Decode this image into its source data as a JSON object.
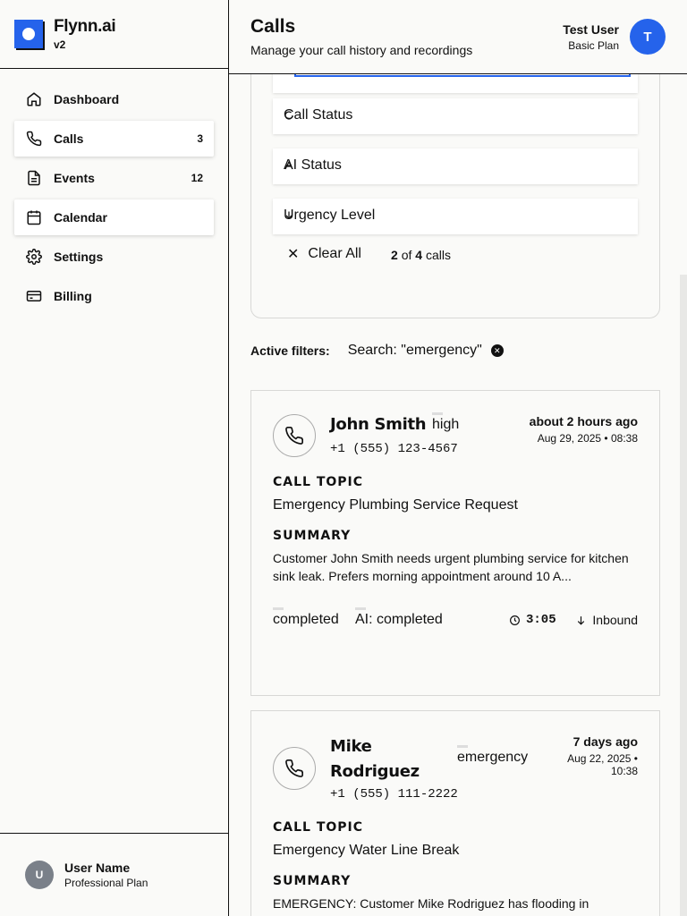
{
  "brand": {
    "name": "Flynn.ai",
    "version": "v2"
  },
  "nav": [
    {
      "label": "Dashboard",
      "icon": "home-icon",
      "count": ""
    },
    {
      "label": "Calls",
      "icon": "phone-icon",
      "count": "3"
    },
    {
      "label": "Events",
      "icon": "document-icon",
      "count": "12"
    },
    {
      "label": "Calendar",
      "icon": "calendar-icon",
      "count": ""
    },
    {
      "label": "Settings",
      "icon": "gear-icon",
      "count": ""
    },
    {
      "label": "Billing",
      "icon": "credit-card-icon",
      "count": ""
    }
  ],
  "sidebar_user": {
    "initial": "U",
    "name": "User Name",
    "plan": "Professional Plan"
  },
  "header": {
    "title": "Calls",
    "subtitle": "Manage your call history and recordings",
    "user": {
      "name": "Test User",
      "plan": "Basic Plan",
      "initial": "T"
    }
  },
  "filters": {
    "search_value": "emergency",
    "call_status": "Call Status",
    "ai_status": "AI Status",
    "urgency": "Urgency Level",
    "clear_all": "Clear All",
    "count_shown": "2",
    "count_of": "of",
    "count_total": "4",
    "count_suffix": "calls"
  },
  "active_filters": {
    "label": "Active filters:",
    "chip": "Search: \"emergency\""
  },
  "calls": [
    {
      "name": "John Smith",
      "urgency": "high",
      "phone": "+1 (555) 123-4567",
      "time_ago": "about 2 hours ago",
      "date": "Aug 29, 2025 • 08:38",
      "topic_label": "CALL TOPIC",
      "topic": "Emergency Plumbing Service Request",
      "summary_label": "SUMMARY",
      "summary": "Customer John Smith needs urgent plumbing service for kitchen sink leak. Prefers morning appointment around 10 A...",
      "call_status": "completed",
      "ai_status": "AI: completed",
      "duration": "3:05",
      "direction": "Inbound"
    },
    {
      "name_line1": "Mike",
      "name_line2": "Rodriguez",
      "urgency": "emergency",
      "phone": "+1 (555) 111-2222",
      "time_ago": "7 days ago",
      "date_line1": "Aug 22, 2025 •",
      "date_line2": "10:38",
      "topic_label": "CALL TOPIC",
      "topic": "Emergency Water Line Break",
      "summary_label": "SUMMARY",
      "summary": "EMERGENCY: Customer Mike Rodriguez has flooding in"
    }
  ],
  "colors": {
    "accent": "#2563eb",
    "border": "#111111",
    "background": "#fafaf8"
  }
}
